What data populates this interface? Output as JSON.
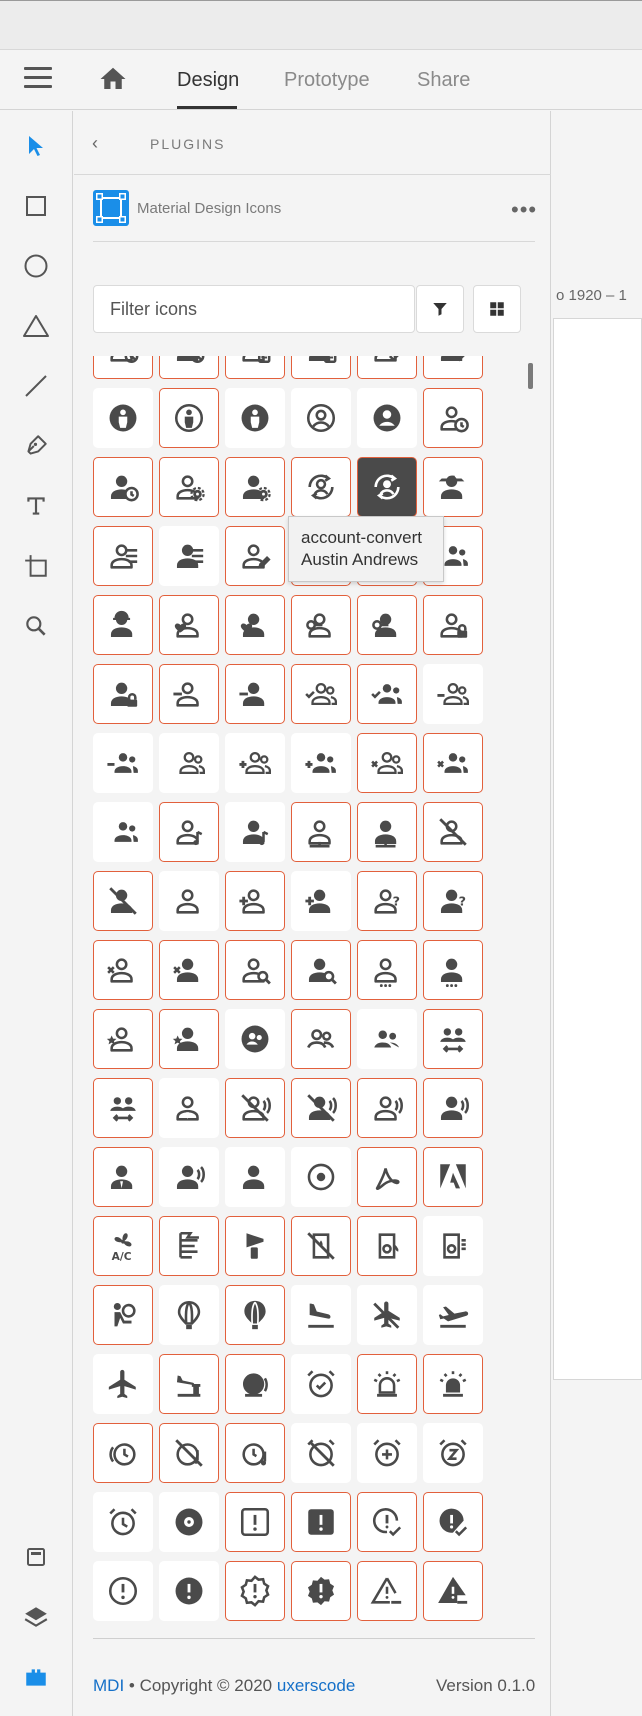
{
  "topbar": {
    "tabs": [
      {
        "label": "Design"
      },
      {
        "label": "Prototype"
      },
      {
        "label": "Share"
      }
    ]
  },
  "plugins": {
    "header": "PLUGINS",
    "plugin_name": "Material Design Icons",
    "more": "•••"
  },
  "filter": {
    "placeholder": "Filter icons",
    "value": ""
  },
  "artboard": {
    "label": "o 1920 – 1"
  },
  "tooltip": {
    "line1": "account-convert",
    "line2": "Austin Andrews"
  },
  "footer": {
    "mdi": "MDI",
    "sep": " • ",
    "copyright": "Copyright © 2020 ",
    "author": "uxerscode",
    "version": "Version 0.1.0"
  },
  "colors": {
    "accent": "#e2603c",
    "link": "#1570c8",
    "logo": "#1a8ee8",
    "select": "#1a8ee8"
  },
  "icons": [
    {
      "name": "account-cancel-outline-icon",
      "k": "cancel",
      "o": 1,
      "m": 1
    },
    {
      "name": "account-cancel-icon",
      "k": "cancel",
      "o": 0,
      "m": 1
    },
    {
      "name": "account-card-details-outline-icon",
      "k": "card",
      "o": 1,
      "m": 1
    },
    {
      "name": "account-card-details-icon",
      "k": "card",
      "o": 0,
      "m": 1
    },
    {
      "name": "account-check-outline-icon",
      "k": "check",
      "o": 1,
      "m": 1
    },
    {
      "name": "account-check-icon",
      "k": "check",
      "o": 0,
      "m": 1
    },
    {
      "name": "account-child-circle-icon",
      "k": "child",
      "o": 0,
      "m": 0
    },
    {
      "name": "account-child-outline-icon",
      "k": "child",
      "o": 1,
      "m": 1
    },
    {
      "name": "account-child-icon",
      "k": "child",
      "o": 0,
      "m": 0
    },
    {
      "name": "account-circle-outline-icon",
      "k": "circle",
      "o": 1,
      "m": 0
    },
    {
      "name": "account-circle-icon",
      "k": "circle",
      "o": 0,
      "m": 0
    },
    {
      "name": "account-clock-outline-icon",
      "k": "clock",
      "o": 1,
      "m": 1
    },
    {
      "name": "account-clock-icon",
      "k": "clock",
      "o": 0,
      "m": 1
    },
    {
      "name": "account-cog-outline-icon",
      "k": "cog",
      "o": 1,
      "m": 1
    },
    {
      "name": "account-cog-icon",
      "k": "cog",
      "o": 0,
      "m": 1
    },
    {
      "name": "account-convert-outline-icon",
      "k": "convert",
      "o": 1,
      "m": 1
    },
    {
      "name": "account-convert-icon",
      "k": "convert",
      "o": 0,
      "m": 1,
      "dark": 1
    },
    {
      "name": "account-cowboy-hat-icon",
      "k": "cowboy",
      "o": 0,
      "m": 1
    },
    {
      "name": "account-details-outline-icon",
      "k": "details",
      "o": 1,
      "m": 1
    },
    {
      "name": "account-details-icon",
      "k": "details",
      "o": 0,
      "m": 0
    },
    {
      "name": "account-edit-outline-icon",
      "k": "edit",
      "o": 1,
      "m": 1
    },
    {
      "name": "account-edit-icon",
      "k": "edit",
      "o": 0,
      "m": 1
    },
    {
      "name": "account-group-outline-icon",
      "k": "group",
      "o": 1,
      "m": 1
    },
    {
      "name": "account-group-icon",
      "k": "group",
      "o": 0,
      "m": 1
    },
    {
      "name": "account-hard-hat-icon",
      "k": "hardhat",
      "o": 0,
      "m": 1
    },
    {
      "name": "account-heart-outline-icon",
      "k": "heart",
      "o": 1,
      "m": 1
    },
    {
      "name": "account-heart-icon",
      "k": "heart",
      "o": 0,
      "m": 1
    },
    {
      "name": "account-key-outline-icon",
      "k": "key",
      "o": 1,
      "m": 1
    },
    {
      "name": "account-key-icon",
      "k": "key",
      "o": 0,
      "m": 1
    },
    {
      "name": "account-lock-outline-icon",
      "k": "lock",
      "o": 1,
      "m": 1
    },
    {
      "name": "account-lock-icon",
      "k": "lock",
      "o": 0,
      "m": 1
    },
    {
      "name": "account-minus-outline-icon",
      "k": "minus",
      "o": 1,
      "m": 1
    },
    {
      "name": "account-minus-icon",
      "k": "minus",
      "o": 0,
      "m": 1
    },
    {
      "name": "account-multiple-check-outline-icon",
      "k": "mcheck",
      "o": 1,
      "m": 1
    },
    {
      "name": "account-multiple-check-icon",
      "k": "mcheck",
      "o": 0,
      "m": 1
    },
    {
      "name": "account-multiple-minus-outline-icon",
      "k": "mminus",
      "o": 1,
      "m": 0
    },
    {
      "name": "account-multiple-minus-icon",
      "k": "mminus",
      "o": 0,
      "m": 0
    },
    {
      "name": "account-multiple-outline-icon",
      "k": "multiple",
      "o": 1,
      "m": 0
    },
    {
      "name": "account-multiple-plus-outline-icon",
      "k": "mplus",
      "o": 1,
      "m": 0
    },
    {
      "name": "account-multiple-plus-icon",
      "k": "mplus",
      "o": 0,
      "m": 0
    },
    {
      "name": "account-multiple-remove-outline-icon",
      "k": "mremove",
      "o": 1,
      "m": 1
    },
    {
      "name": "account-multiple-remove-icon",
      "k": "mremove",
      "o": 0,
      "m": 1
    },
    {
      "name": "account-multiple-icon",
      "k": "multiple",
      "o": 0,
      "m": 0
    },
    {
      "name": "account-music-outline-icon",
      "k": "music",
      "o": 1,
      "m": 1
    },
    {
      "name": "account-music-icon",
      "k": "music",
      "o": 0,
      "m": 0
    },
    {
      "name": "account-network-outline-icon",
      "k": "network",
      "o": 1,
      "m": 1
    },
    {
      "name": "account-network-icon",
      "k": "network",
      "o": 0,
      "m": 1
    },
    {
      "name": "account-off-outline-icon",
      "k": "off",
      "o": 1,
      "m": 1
    },
    {
      "name": "account-off-icon",
      "k": "off",
      "o": 0,
      "m": 1
    },
    {
      "name": "account-outline-icon",
      "k": "person",
      "o": 1,
      "m": 0
    },
    {
      "name": "account-plus-outline-icon",
      "k": "plus",
      "o": 1,
      "m": 1
    },
    {
      "name": "account-plus-icon",
      "k": "plus",
      "o": 0,
      "m": 0
    },
    {
      "name": "account-question-outline-icon",
      "k": "question",
      "o": 1,
      "m": 1
    },
    {
      "name": "account-question-icon",
      "k": "question",
      "o": 0,
      "m": 1
    },
    {
      "name": "account-remove-outline-icon",
      "k": "remove",
      "o": 1,
      "m": 1
    },
    {
      "name": "account-remove-icon",
      "k": "remove",
      "o": 0,
      "m": 1
    },
    {
      "name": "account-search-outline-icon",
      "k": "search",
      "o": 1,
      "m": 1
    },
    {
      "name": "account-search-icon",
      "k": "search",
      "o": 0,
      "m": 1
    },
    {
      "name": "account-settings-outline-icon",
      "k": "settings",
      "o": 1,
      "m": 1
    },
    {
      "name": "account-settings-icon",
      "k": "settings",
      "o": 0,
      "m": 1
    },
    {
      "name": "account-star-outline-icon",
      "k": "star",
      "o": 1,
      "m": 1
    },
    {
      "name": "account-star-icon",
      "k": "star",
      "o": 0,
      "m": 1
    },
    {
      "name": "account-supervisor-circle-icon",
      "k": "supcircle",
      "o": 0,
      "m": 0
    },
    {
      "name": "account-supervisor-outline-icon",
      "k": "supervisor",
      "o": 1,
      "m": 1
    },
    {
      "name": "account-supervisor-icon",
      "k": "supervisor",
      "o": 0,
      "m": 0
    },
    {
      "name": "account-switch-icon",
      "k": "switch",
      "o": 0,
      "m": 1
    },
    {
      "name": "account-switch-outline-icon",
      "k": "switch",
      "o": 0,
      "m": 1
    },
    {
      "name": "account-tie-outline-icon",
      "k": "tie",
      "o": 1,
      "m": 0
    },
    {
      "name": "account-tie-voice-off-outline-icon",
      "k": "voiceoff",
      "o": 1,
      "m": 1
    },
    {
      "name": "account-tie-voice-off-icon",
      "k": "voiceoff",
      "o": 0,
      "m": 1
    },
    {
      "name": "account-tie-voice-outline-icon",
      "k": "voice",
      "o": 1,
      "m": 1
    },
    {
      "name": "account-tie-voice-icon",
      "k": "voice",
      "o": 0,
      "m": 1
    },
    {
      "name": "account-tie-icon",
      "k": "tie",
      "o": 0,
      "m": 1
    },
    {
      "name": "account-voice-icon",
      "k": "voice",
      "o": 0,
      "m": 0
    },
    {
      "name": "account-icon",
      "k": "person",
      "o": 0,
      "m": 0
    },
    {
      "name": "adjust-icon",
      "k": "adjust",
      "o": 0,
      "m": 0
    },
    {
      "name": "adobe-acrobat-icon",
      "k": "acrobat",
      "o": 0,
      "m": 1
    },
    {
      "name": "adobe-icon",
      "k": "adobe",
      "o": 0,
      "m": 1
    },
    {
      "name": "air-conditioner-icon",
      "k": "ac",
      "o": 0,
      "m": 1
    },
    {
      "name": "air-filter-icon",
      "k": "filter",
      "o": 0,
      "m": 1
    },
    {
      "name": "air-horn-icon",
      "k": "horn",
      "o": 0,
      "m": 1
    },
    {
      "name": "air-humidifier-off-icon",
      "k": "humoff",
      "o": 0,
      "m": 1
    },
    {
      "name": "air-humidifier-icon",
      "k": "hum",
      "o": 0,
      "m": 1
    },
    {
      "name": "air-purifier-icon",
      "k": "purifier",
      "o": 0,
      "m": 0
    },
    {
      "name": "airbag-icon",
      "k": "airbag",
      "o": 0,
      "m": 1
    },
    {
      "name": "airballoon-outline-icon",
      "k": "balloon",
      "o": 1,
      "m": 0
    },
    {
      "name": "airballoon-icon",
      "k": "balloon",
      "o": 0,
      "m": 1
    },
    {
      "name": "airplane-landing-icon",
      "k": "landing",
      "o": 0,
      "m": 0
    },
    {
      "name": "airplane-off-icon",
      "k": "planeoff",
      "o": 0,
      "m": 0
    },
    {
      "name": "airplane-takeoff-icon",
      "k": "takeoff",
      "o": 0,
      "m": 0
    },
    {
      "name": "airplane-icon",
      "k": "plane",
      "o": 0,
      "m": 0
    },
    {
      "name": "airport-icon",
      "k": "airport",
      "o": 0,
      "m": 1
    },
    {
      "name": "alarm-bell-icon",
      "k": "bell",
      "o": 0,
      "m": 1
    },
    {
      "name": "alarm-check-icon",
      "k": "acheck",
      "o": 0,
      "m": 0
    },
    {
      "name": "alarm-light-outline-icon",
      "k": "light",
      "o": 1,
      "m": 1
    },
    {
      "name": "alarm-light-icon",
      "k": "light",
      "o": 0,
      "m": 1
    },
    {
      "name": "alarm-multiple-icon",
      "k": "amulti",
      "o": 0,
      "m": 1
    },
    {
      "name": "alarm-note-off-icon",
      "k": "noteoff",
      "o": 0,
      "m": 1
    },
    {
      "name": "alarm-note-icon",
      "k": "note",
      "o": 0,
      "m": 1
    },
    {
      "name": "alarm-off-icon",
      "k": "aoff",
      "o": 0,
      "m": 0
    },
    {
      "name": "alarm-plus-icon",
      "k": "aplus",
      "o": 0,
      "m": 0
    },
    {
      "name": "alarm-snooze-icon",
      "k": "snooze",
      "o": 0,
      "m": 0
    },
    {
      "name": "alarm-icon",
      "k": "alarm",
      "o": 0,
      "m": 0
    },
    {
      "name": "album-icon",
      "k": "album",
      "o": 0,
      "m": 0
    },
    {
      "name": "alert-box-outline-icon",
      "k": "abox",
      "o": 1,
      "m": 1
    },
    {
      "name": "alert-box-icon",
      "k": "abox",
      "o": 0,
      "m": 1
    },
    {
      "name": "alert-circle-check-outline-icon",
      "k": "accheck",
      "o": 1,
      "m": 1
    },
    {
      "name": "alert-circle-check-icon",
      "k": "accheck",
      "o": 0,
      "m": 1
    },
    {
      "name": "alert-circle-outline-icon",
      "k": "acircle",
      "o": 1,
      "m": 0
    },
    {
      "name": "alert-circle-icon",
      "k": "acircle",
      "o": 0,
      "m": 0
    },
    {
      "name": "alert-decagram-outline-icon",
      "k": "decagram",
      "o": 1,
      "m": 1
    },
    {
      "name": "alert-decagram-icon",
      "k": "decagram",
      "o": 0,
      "m": 1
    },
    {
      "name": "alert-minus-outline-icon",
      "k": "aminus",
      "o": 1,
      "m": 1
    },
    {
      "name": "alert-minus-icon",
      "k": "aminus",
      "o": 0,
      "m": 1
    }
  ]
}
